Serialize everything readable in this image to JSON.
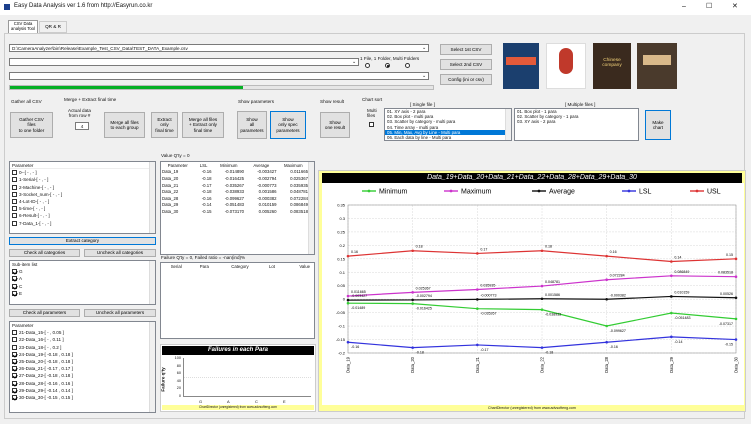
{
  "window": {
    "title": "Easy Data Analysis ver 1.6 from http://Easyrun.co.kr",
    "min": "–",
    "max": "☐",
    "close": "✕"
  },
  "tabs": [
    {
      "label": "CSV Data\nanalysis Tool"
    },
    {
      "label": "QR & R"
    }
  ],
  "path_input": {
    "value": "D:\\CameraAnalyzer\\bin\\Release\\Example_Test_CSV_Data\\TEST_DATA_Example.csv"
  },
  "file_mode": {
    "label": "1 File, 1 Folder, Multi Folders",
    "selected": 1
  },
  "buttons": {
    "select1": "Select 1st CSV",
    "select2": "Select 2nd CSV",
    "config": "Config (ini or csv)"
  },
  "progress": {
    "fraction": 0.55
  },
  "toolbar": {
    "gather_label": "Gather all CSV",
    "gather_btn": "Gather CSV\nfiles\nto one folder",
    "merge_label": "Merge + Extract final time",
    "actual_label": "Actual data\nfrom row #",
    "row_value": "4",
    "merge_each": "Merge all files\nto each group",
    "extract_only": "Extract\nonly\nfinal time",
    "merge_extract": "Merge all files\n+ Extract only\nfinal time",
    "show_params_label": "Show parameters",
    "show_all": "Show\nall\nparameters",
    "show_spec": "Show\nonly spec\nparameters",
    "show_result_label": "Show result",
    "show_one": "Show\none result",
    "chart_sort_label": "Chart sort",
    "multi_files": "Multi\nfiles",
    "make_chart": "Make\nchart"
  },
  "single_file": {
    "label": "[ Single file ]",
    "items": [
      "01. XY axis - 2 para",
      "02. Box plot - multi para",
      "03. Scatter by category - multi para",
      "04. Time array - multi para",
      "05. Min, Max, Avg by Line - Multi para",
      "06. Each data by line - Multi para"
    ],
    "selected": 4
  },
  "multi_files": {
    "label": "[ Multiple files ]",
    "items": [
      "01. Box plot - 1 para",
      "02. Scatter by category - 1 para",
      "03. XY axis - 2 para"
    ]
  },
  "books": [
    {
      "title": "",
      "color": "#1b3f6e"
    },
    {
      "title": "",
      "color": "#c0392b"
    },
    {
      "title": "Chinese\ncompany",
      "color": "#3a2a1e"
    },
    {
      "title": "",
      "color": "#4a3a2c"
    }
  ],
  "param_panel": {
    "header": "Parameter",
    "items": [
      {
        "label": "0--[ - , - ]",
        "checked": false
      },
      {
        "label": "1-Serial-[ - , - ]",
        "checked": false
      },
      {
        "label": "2-Machine-[ - , - ]",
        "checked": false
      },
      {
        "label": "3-Socket_num-[ - , - ]",
        "checked": false
      },
      {
        "label": "4-Lot-ID-[ - , - ]",
        "checked": false
      },
      {
        "label": "5-time-[ - , - ]",
        "checked": false
      },
      {
        "label": "6-Result-[ - , - ]",
        "checked": false
      },
      {
        "label": "7-Data_1-[ - , - ]",
        "checked": false
      }
    ]
  },
  "extract_category": "Extract category",
  "check_all_categories": "Check all categories",
  "uncheck_all_categories": "Uncheck all categories",
  "subitem_panel": {
    "header": "Sub-item list",
    "items": [
      {
        "label": "G",
        "checked": true
      },
      {
        "label": "A",
        "checked": true
      },
      {
        "label": "C",
        "checked": true
      },
      {
        "label": "E",
        "checked": true
      }
    ]
  },
  "check_all_params": "Check all parameters",
  "uncheck_all_params": "Uncheck all parameters",
  "param2_panel": {
    "header": "Parameter",
    "items": [
      {
        "label": "21-Data_15-[ - , 0.05 ]",
        "checked": false
      },
      {
        "label": "22-Data_16-[ - , 0.11 ]",
        "checked": false
      },
      {
        "label": "23-Data_18-[ - , 0.2 ]",
        "checked": false
      },
      {
        "label": "24-Data_19-[ -0.18 , 0.18 ]",
        "checked": true
      },
      {
        "label": "25-Data_20-[ -0.18 , 0.18 ]",
        "checked": true
      },
      {
        "label": "26-Data_21-[ -0.17 , 0.17 ]",
        "checked": true
      },
      {
        "label": "27-Data_22-[ -0.18 , 0.18 ]",
        "checked": true
      },
      {
        "label": "28-Data_28-[ -0.16 , 0.16 ]",
        "checked": true
      },
      {
        "label": "29-Data_29-[ -0.14 , 0.14 ]",
        "checked": true
      },
      {
        "label": "30-Data_30-[ -0.15 , 0.15 ]",
        "checked": true
      }
    ]
  },
  "value_table": {
    "title": "Value Q'ty = 0",
    "columns": [
      "Parameter",
      "LSL",
      "Minimum",
      "Average",
      "Maximum"
    ],
    "rows": [
      [
        "Data_19",
        "-0.16",
        "-0.014890",
        "-0.003427",
        "0.011665"
      ],
      [
        "Data_20",
        "-0.18",
        "-0.016425",
        "-0.002794",
        "0.025367"
      ],
      [
        "Data_21",
        "-0.17",
        "-0.035267",
        "-0.000773",
        "0.035935"
      ],
      [
        "Data_22",
        "-0.18",
        "-0.038933",
        "0.001586",
        "0.048781"
      ],
      [
        "Data_28",
        "-0.16",
        "-0.099627",
        "-0.000382",
        "0.072284"
      ],
      [
        "Data_29",
        "-0.14",
        "-0.051483",
        "0.010159",
        "0.086849"
      ],
      [
        "Data_30",
        "-0.15",
        "-0.073170",
        "0.005260",
        "0.083518"
      ]
    ]
  },
  "failure_table": {
    "title": "Failure Q'ty = 0, Failed ratio = -nan(ind)%",
    "columns": [
      "Serial",
      "Para",
      "Category",
      "Lot",
      "Value"
    ]
  },
  "fail_chart": {
    "title": "Failures in each Para",
    "ylabel": "Failure q'ty",
    "yticks": [
      "100",
      "80",
      "60",
      "40",
      "20",
      "0"
    ],
    "categories": [
      "G",
      "A",
      "C",
      "E"
    ],
    "footer": "ChartDirector (unregistered) from www.advsofteng.com"
  },
  "main_chart": {
    "footer": "ChartDirector (unregistered) from www.advsofteng.com"
  },
  "chart_data": {
    "type": "line",
    "title": "Data_19+Data_20+Data_21+Data_22+Data_28+Data_29+Data_30",
    "categories": [
      "Data_19",
      "Data_20",
      "Data_21",
      "Data_22",
      "Data_28",
      "Data_29",
      "Data_30"
    ],
    "ylim": [
      -0.2,
      0.35
    ],
    "yticks": [
      0.35,
      0.3,
      0.25,
      0.2,
      0.15,
      0.1,
      0.05,
      0,
      -0.05,
      -0.1,
      -0.15,
      -0.2
    ],
    "ytick_labels": [
      "0.35",
      "0.3",
      "0.25",
      "0.2",
      "0.15",
      "0.1",
      "0.05",
      "0",
      "-0.05",
      "-0.1",
      "-0.15",
      "-0.2"
    ],
    "grid": true,
    "legend": "top",
    "series": [
      {
        "name": "Minimum",
        "color": "#33cc33",
        "values": [
          -0.01489,
          -0.016425,
          -0.035267,
          -0.038933,
          -0.099627,
          -0.051483,
          -0.07317
        ],
        "labels": [
          "-0.01489",
          "-0.016425",
          "-0.035267",
          "-0.038933",
          "-0.099627",
          "-0.051483",
          "-0.07317"
        ]
      },
      {
        "name": "Maximum",
        "color": "#cc33cc",
        "values": [
          0.011665,
          0.025367,
          0.035935,
          0.048781,
          0.072284,
          0.086849,
          0.083518
        ],
        "labels": [
          "0.011665",
          "0.025367",
          "0.035935",
          "0.048781",
          "0.072284",
          "0.086849",
          "0.083518"
        ]
      },
      {
        "name": "Average",
        "color": "#111111",
        "values": [
          -0.003427,
          -0.002794,
          -0.000773,
          0.001586,
          -0.000382,
          0.010159,
          0.00526
        ],
        "labels": [
          "-0.003427",
          "-0.002794",
          "-0.000773",
          "0.001586",
          "-0.000382",
          "0.010159",
          "0.00526"
        ]
      },
      {
        "name": "LSL",
        "color": "#3333dd",
        "values": [
          -0.16,
          -0.18,
          -0.17,
          -0.18,
          -0.16,
          -0.14,
          -0.15
        ],
        "labels": [
          "-0.16",
          "-0.18",
          "-0.17",
          "-0.18",
          "-0.16",
          "-0.14",
          "-0.15"
        ]
      },
      {
        "name": "USL",
        "color": "#dd3333",
        "values": [
          0.16,
          0.18,
          0.17,
          0.18,
          0.16,
          0.14,
          0.15
        ],
        "labels": [
          "0.16",
          "0.18",
          "0.17",
          "0.18",
          "0.16",
          "0.14",
          "0.15"
        ]
      }
    ]
  }
}
